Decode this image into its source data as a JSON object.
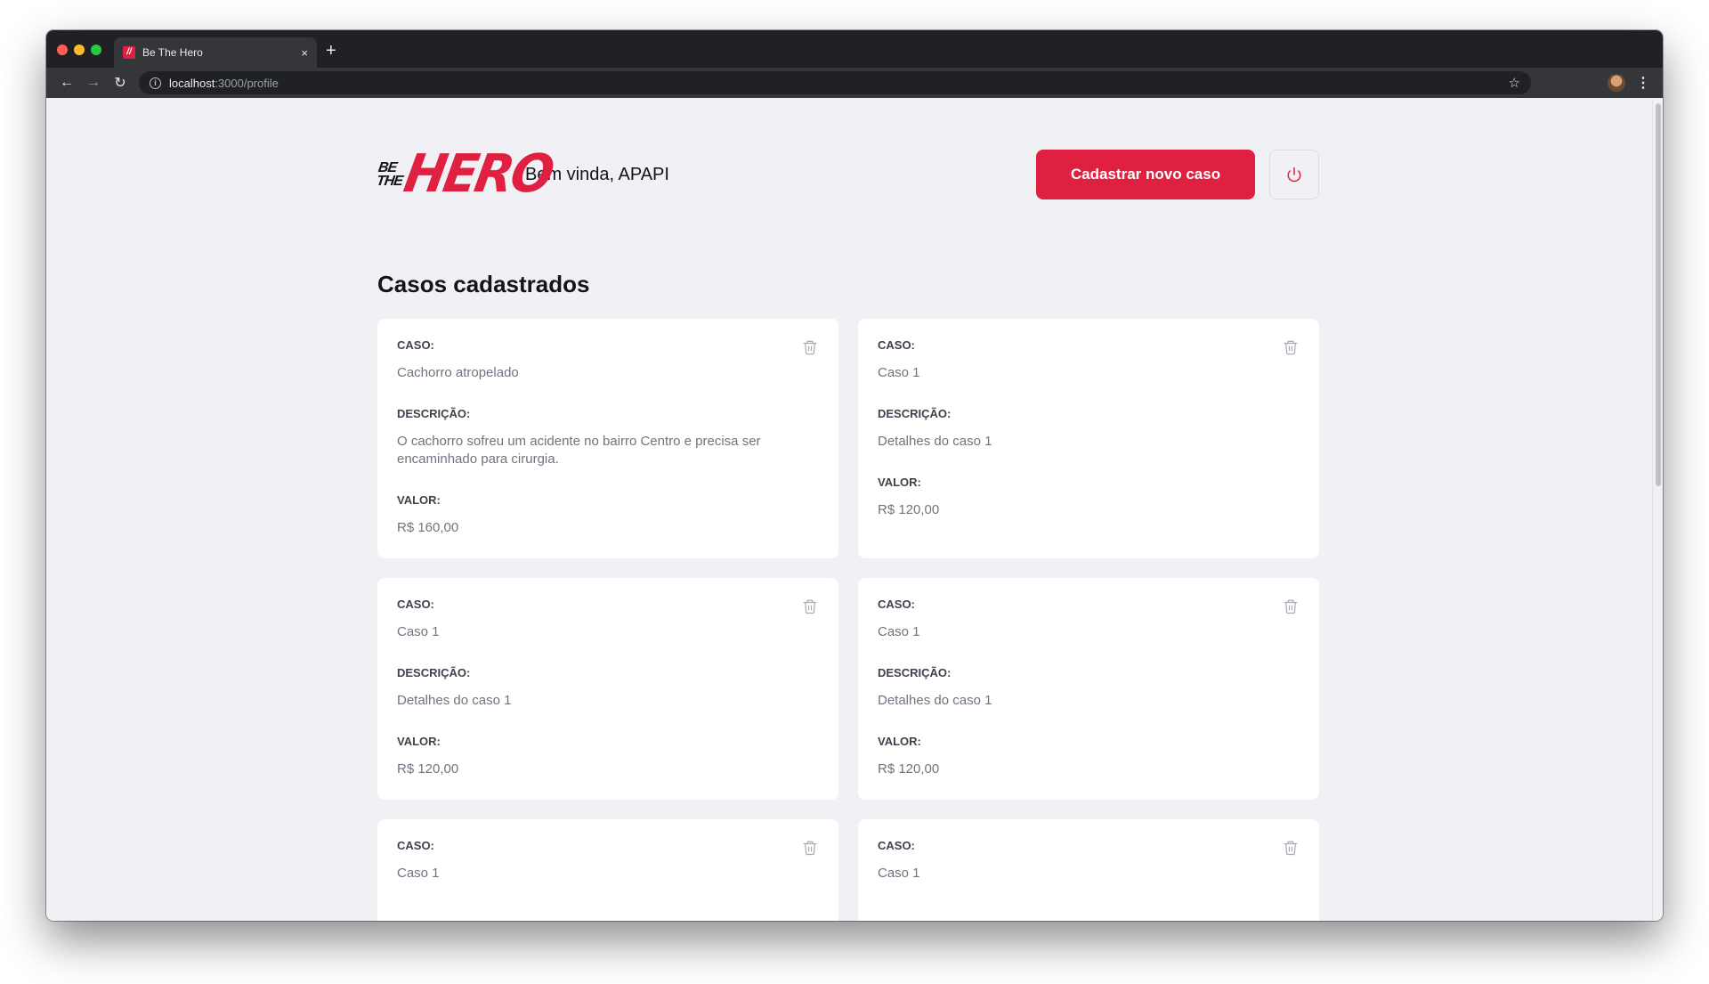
{
  "browser": {
    "tab_title": "Be The Hero",
    "tab_close": "×",
    "new_tab": "+",
    "url_host": "localhost",
    "url_rest": ":3000/profile",
    "back": "←",
    "forward": "→",
    "reload": "↻",
    "info": "i",
    "star": "☆",
    "menu": "⋮"
  },
  "header": {
    "logo_be": "BE",
    "logo_the": "THE",
    "logo_hero": "HERO",
    "welcome": "Bem vinda, APAPI",
    "new_case_label": "Cadastrar novo caso",
    "accent_color": "#e02041"
  },
  "page_title": "Casos cadastrados",
  "labels": {
    "case": "CASO:",
    "description": "DESCRIÇÃO:",
    "value": "VALOR:"
  },
  "cases": [
    {
      "title": "Cachorro atropelado",
      "description": "O cachorro sofreu um acidente no bairro Centro e precisa ser encaminhado para cirurgia.",
      "value": "R$ 160,00"
    },
    {
      "title": "Caso 1",
      "description": "Detalhes do caso 1",
      "value": "R$ 120,00"
    },
    {
      "title": "Caso 1",
      "description": "Detalhes do caso 1",
      "value": "R$ 120,00"
    },
    {
      "title": "Caso 1",
      "description": "Detalhes do caso 1",
      "value": "R$ 120,00"
    },
    {
      "title": "Caso 1"
    },
    {
      "title": "Caso 1"
    }
  ]
}
